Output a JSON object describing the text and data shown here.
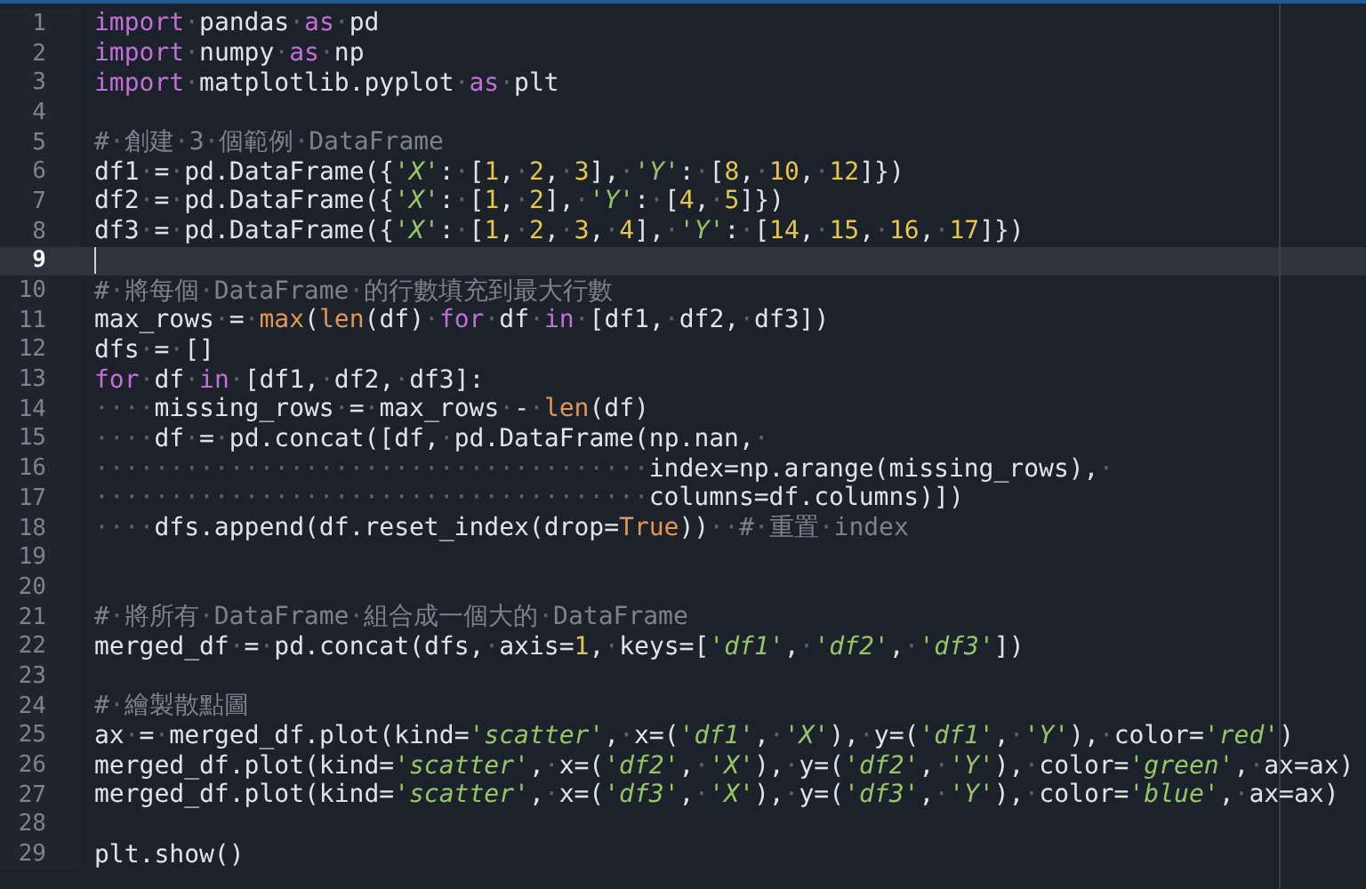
{
  "editor": {
    "lines": [
      {
        "number": "1",
        "current": false,
        "tokens": [
          {
            "kind": "keyword",
            "text": "import"
          },
          {
            "kind": "plain",
            "text": "·pandas·"
          },
          {
            "kind": "keyword",
            "text": "as"
          },
          {
            "kind": "plain",
            "text": "·pd"
          }
        ]
      },
      {
        "number": "2",
        "current": false,
        "tokens": [
          {
            "kind": "keyword",
            "text": "import"
          },
          {
            "kind": "plain",
            "text": "·numpy·"
          },
          {
            "kind": "keyword",
            "text": "as"
          },
          {
            "kind": "plain",
            "text": "·np"
          }
        ]
      },
      {
        "number": "3",
        "current": false,
        "tokens": [
          {
            "kind": "keyword",
            "text": "import"
          },
          {
            "kind": "plain",
            "text": "·matplotlib.pyplot·"
          },
          {
            "kind": "keyword",
            "text": "as"
          },
          {
            "kind": "plain",
            "text": "·plt"
          }
        ]
      },
      {
        "number": "4",
        "current": false
      },
      {
        "number": "5",
        "current": false,
        "tokens": [
          {
            "kind": "comment",
            "text": "#·創建·3·個範例·DataFrame"
          }
        ]
      },
      {
        "number": "6",
        "current": false,
        "tokens": [
          {
            "kind": "plain",
            "text": "df1·=·pd.DataFrame({"
          },
          {
            "kind": "string",
            "text": "'X'"
          },
          {
            "kind": "plain",
            "text": ":·["
          },
          {
            "kind": "number",
            "text": "1"
          },
          {
            "kind": "plain",
            "text": ",·"
          },
          {
            "kind": "number",
            "text": "2"
          },
          {
            "kind": "plain",
            "text": ",·"
          },
          {
            "kind": "number",
            "text": "3"
          },
          {
            "kind": "plain",
            "text": "],·"
          },
          {
            "kind": "string",
            "text": "'Y'"
          },
          {
            "kind": "plain",
            "text": ":·["
          },
          {
            "kind": "number",
            "text": "8"
          },
          {
            "kind": "plain",
            "text": ",·"
          },
          {
            "kind": "number",
            "text": "10"
          },
          {
            "kind": "plain",
            "text": ",·"
          },
          {
            "kind": "number",
            "text": "12"
          },
          {
            "kind": "plain",
            "text": "]})"
          }
        ]
      },
      {
        "number": "7",
        "current": false,
        "tokens": [
          {
            "kind": "plain",
            "text": "df2·=·pd.DataFrame({"
          },
          {
            "kind": "string",
            "text": "'X'"
          },
          {
            "kind": "plain",
            "text": ":·["
          },
          {
            "kind": "number",
            "text": "1"
          },
          {
            "kind": "plain",
            "text": ",·"
          },
          {
            "kind": "number",
            "text": "2"
          },
          {
            "kind": "plain",
            "text": "],·"
          },
          {
            "kind": "string",
            "text": "'Y'"
          },
          {
            "kind": "plain",
            "text": ":·["
          },
          {
            "kind": "number",
            "text": "4"
          },
          {
            "kind": "plain",
            "text": ",·"
          },
          {
            "kind": "number",
            "text": "5"
          },
          {
            "kind": "plain",
            "text": "]})"
          }
        ]
      },
      {
        "number": "8",
        "current": false,
        "tokens": [
          {
            "kind": "plain",
            "text": "df3·=·pd.DataFrame({"
          },
          {
            "kind": "string",
            "text": "'X'"
          },
          {
            "kind": "plain",
            "text": ":·["
          },
          {
            "kind": "number",
            "text": "1"
          },
          {
            "kind": "plain",
            "text": ",·"
          },
          {
            "kind": "number",
            "text": "2"
          },
          {
            "kind": "plain",
            "text": ",·"
          },
          {
            "kind": "number",
            "text": "3"
          },
          {
            "kind": "plain",
            "text": ",·"
          },
          {
            "kind": "number",
            "text": "4"
          },
          {
            "kind": "plain",
            "text": "],·"
          },
          {
            "kind": "string",
            "text": "'Y'"
          },
          {
            "kind": "plain",
            "text": ":·["
          },
          {
            "kind": "number",
            "text": "14"
          },
          {
            "kind": "plain",
            "text": ",·"
          },
          {
            "kind": "number",
            "text": "15"
          },
          {
            "kind": "plain",
            "text": ",·"
          },
          {
            "kind": "number",
            "text": "16"
          },
          {
            "kind": "plain",
            "text": ",·"
          },
          {
            "kind": "number",
            "text": "17"
          },
          {
            "kind": "plain",
            "text": "]})"
          }
        ]
      },
      {
        "number": "9",
        "current": true
      },
      {
        "number": "10",
        "current": false,
        "tokens": [
          {
            "kind": "comment",
            "text": "#·將每個·DataFrame·的行數填充到最大行數"
          }
        ]
      },
      {
        "number": "11",
        "current": false,
        "tokens": [
          {
            "kind": "plain",
            "text": "max_rows·=·"
          },
          {
            "kind": "builtin",
            "text": "max"
          },
          {
            "kind": "plain",
            "text": "("
          },
          {
            "kind": "builtin",
            "text": "len"
          },
          {
            "kind": "plain",
            "text": "(df)·"
          },
          {
            "kind": "keyword",
            "text": "for"
          },
          {
            "kind": "plain",
            "text": "·df·"
          },
          {
            "kind": "keyword",
            "text": "in"
          },
          {
            "kind": "plain",
            "text": "·[df1,·df2,·df3])"
          }
        ]
      },
      {
        "number": "12",
        "current": false,
        "tokens": [
          {
            "kind": "plain",
            "text": "dfs·=·[]"
          }
        ]
      },
      {
        "number": "13",
        "current": false,
        "tokens": [
          {
            "kind": "keyword",
            "text": "for"
          },
          {
            "kind": "plain",
            "text": "·df·"
          },
          {
            "kind": "keyword",
            "text": "in"
          },
          {
            "kind": "plain",
            "text": "·[df1,·df2,·df3]:"
          }
        ]
      },
      {
        "number": "14",
        "current": false,
        "tokens": [
          {
            "kind": "plain",
            "text": "····missing_rows·=·max_rows·-·"
          },
          {
            "kind": "builtin",
            "text": "len"
          },
          {
            "kind": "plain",
            "text": "(df)"
          }
        ]
      },
      {
        "number": "15",
        "current": false,
        "tokens": [
          {
            "kind": "plain",
            "text": "····df·=·pd.concat([df,·pd.DataFrame(np.nan,·"
          }
        ]
      },
      {
        "number": "16",
        "current": false,
        "tokens": [
          {
            "kind": "plain",
            "text": "·····································index=np.arange(missing_rows),·"
          }
        ]
      },
      {
        "number": "17",
        "current": false,
        "tokens": [
          {
            "kind": "plain",
            "text": "·····································columns=df.columns)])"
          }
        ]
      },
      {
        "number": "18",
        "current": false,
        "tokens": [
          {
            "kind": "plain",
            "text": "····dfs.append(df.reset_index(drop="
          },
          {
            "kind": "builtin",
            "text": "True"
          },
          {
            "kind": "plain",
            "text": "))··"
          },
          {
            "kind": "comment",
            "text": "#·重置·index"
          }
        ]
      },
      {
        "number": "19",
        "current": false
      },
      {
        "number": "20",
        "current": false
      },
      {
        "number": "21",
        "current": false,
        "tokens": [
          {
            "kind": "comment",
            "text": "#·將所有·DataFrame·組合成一個大的·DataFrame"
          }
        ]
      },
      {
        "number": "22",
        "current": false,
        "tokens": [
          {
            "kind": "plain",
            "text": "merged_df·=·pd.concat(dfs,·axis="
          },
          {
            "kind": "number",
            "text": "1"
          },
          {
            "kind": "plain",
            "text": ",·keys=["
          },
          {
            "kind": "string",
            "text": "'df1'"
          },
          {
            "kind": "plain",
            "text": ",·"
          },
          {
            "kind": "string",
            "text": "'df2'"
          },
          {
            "kind": "plain",
            "text": ",·"
          },
          {
            "kind": "string",
            "text": "'df3'"
          },
          {
            "kind": "plain",
            "text": "])"
          }
        ]
      },
      {
        "number": "23",
        "current": false
      },
      {
        "number": "24",
        "current": false,
        "tokens": [
          {
            "kind": "comment",
            "text": "#·繪製散點圖"
          }
        ]
      },
      {
        "number": "25",
        "current": false,
        "tokens": [
          {
            "kind": "plain",
            "text": "ax·=·merged_df.plot(kind="
          },
          {
            "kind": "string",
            "text": "'scatter'"
          },
          {
            "kind": "plain",
            "text": ",·x=("
          },
          {
            "kind": "string",
            "text": "'df1'"
          },
          {
            "kind": "plain",
            "text": ",·"
          },
          {
            "kind": "string",
            "text": "'X'"
          },
          {
            "kind": "plain",
            "text": "),·y=("
          },
          {
            "kind": "string",
            "text": "'df1'"
          },
          {
            "kind": "plain",
            "text": ",·"
          },
          {
            "kind": "string",
            "text": "'Y'"
          },
          {
            "kind": "plain",
            "text": "),·color="
          },
          {
            "kind": "string",
            "text": "'red'"
          },
          {
            "kind": "plain",
            "text": ")"
          }
        ]
      },
      {
        "number": "26",
        "current": false,
        "tokens": [
          {
            "kind": "plain",
            "text": "merged_df.plot(kind="
          },
          {
            "kind": "string",
            "text": "'scatter'"
          },
          {
            "kind": "plain",
            "text": ",·x=("
          },
          {
            "kind": "string",
            "text": "'df2'"
          },
          {
            "kind": "plain",
            "text": ",·"
          },
          {
            "kind": "string",
            "text": "'X'"
          },
          {
            "kind": "plain",
            "text": "),·y=("
          },
          {
            "kind": "string",
            "text": "'df2'"
          },
          {
            "kind": "plain",
            "text": ",·"
          },
          {
            "kind": "string",
            "text": "'Y'"
          },
          {
            "kind": "plain",
            "text": "),·color="
          },
          {
            "kind": "string",
            "text": "'green'"
          },
          {
            "kind": "plain",
            "text": ",·ax=ax)"
          }
        ]
      },
      {
        "number": "27",
        "current": false,
        "tokens": [
          {
            "kind": "plain",
            "text": "merged_df.plot(kind="
          },
          {
            "kind": "string",
            "text": "'scatter'"
          },
          {
            "kind": "plain",
            "text": ",·x=("
          },
          {
            "kind": "string",
            "text": "'df3'"
          },
          {
            "kind": "plain",
            "text": ",·"
          },
          {
            "kind": "string",
            "text": "'X'"
          },
          {
            "kind": "plain",
            "text": "),·y=("
          },
          {
            "kind": "string",
            "text": "'df3'"
          },
          {
            "kind": "plain",
            "text": ",·"
          },
          {
            "kind": "string",
            "text": "'Y'"
          },
          {
            "kind": "plain",
            "text": "),·color="
          },
          {
            "kind": "string",
            "text": "'blue'"
          },
          {
            "kind": "plain",
            "text": ",·ax=ax)"
          }
        ]
      },
      {
        "number": "28",
        "current": false
      },
      {
        "number": "29",
        "current": false,
        "tokens": [
          {
            "kind": "plain",
            "text": "plt.show()"
          }
        ]
      }
    ]
  }
}
